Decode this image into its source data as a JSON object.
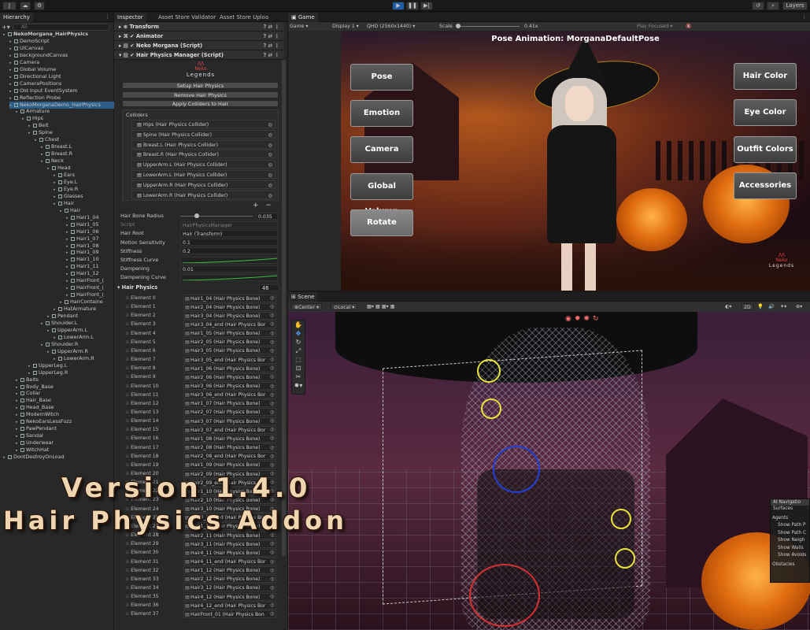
{
  "toolbar": {
    "account": "J",
    "layers_label": "Layers"
  },
  "hierarchy": {
    "tab_label": "Hierarchy",
    "search_placeholder": "All",
    "rows": [
      {
        "label": "NekoMorgana_HairPhysics",
        "indent": 0,
        "bold": true
      },
      {
        "label": "DemoScript",
        "indent": 1
      },
      {
        "label": "UICanvas",
        "indent": 1
      },
      {
        "label": "backgroundCanvas",
        "indent": 1
      },
      {
        "label": "Camera",
        "indent": 1
      },
      {
        "label": "Global Volume",
        "indent": 1
      },
      {
        "label": "Directional Light",
        "indent": 1
      },
      {
        "label": "CameraPositions",
        "indent": 1
      },
      {
        "label": "Old Input EventSystem",
        "indent": 1
      },
      {
        "label": "Reflection Probe",
        "indent": 1
      },
      {
        "label": "NekoMorganaDemo_HairPhysics",
        "indent": 1
      },
      {
        "label": "Armature",
        "indent": 2
      },
      {
        "label": "Hips",
        "indent": 3
      },
      {
        "label": "Belt",
        "indent": 4
      },
      {
        "label": "Spine",
        "indent": 4
      },
      {
        "label": "Chest",
        "indent": 5
      },
      {
        "label": "Breast.L",
        "indent": 6
      },
      {
        "label": "Breast.R",
        "indent": 6
      },
      {
        "label": "Neck",
        "indent": 6
      },
      {
        "label": "Head",
        "indent": 7
      },
      {
        "label": "Ears",
        "indent": 8
      },
      {
        "label": "Eye.L",
        "indent": 8
      },
      {
        "label": "Eye.R",
        "indent": 8
      },
      {
        "label": "Glasses",
        "indent": 8
      },
      {
        "label": "Hair",
        "indent": 8
      },
      {
        "label": "Hair",
        "indent": 9
      },
      {
        "label": "Hair1_04",
        "indent": 10
      },
      {
        "label": "Hair1_05",
        "indent": 10
      },
      {
        "label": "Hair1_06",
        "indent": 10
      },
      {
        "label": "Hair1_07",
        "indent": 10
      },
      {
        "label": "Hair1_08",
        "indent": 10
      },
      {
        "label": "Hair1_09",
        "indent": 10
      },
      {
        "label": "Hair1_10",
        "indent": 10
      },
      {
        "label": "Hair1_11",
        "indent": 10
      },
      {
        "label": "Hair1_12",
        "indent": 10
      },
      {
        "label": "HairFront_(",
        "indent": 10
      },
      {
        "label": "HairFront_(",
        "indent": 10
      },
      {
        "label": "HairFront_(",
        "indent": 10
      },
      {
        "label": "HairContaine",
        "indent": 9
      },
      {
        "label": "HatArmature",
        "indent": 8
      },
      {
        "label": "Pendant",
        "indent": 7
      },
      {
        "label": "Shoulder.L",
        "indent": 6
      },
      {
        "label": "UpperArm.L",
        "indent": 7
      },
      {
        "label": "LowerArm.L",
        "indent": 8
      },
      {
        "label": "Shoulder.R",
        "indent": 6
      },
      {
        "label": "UpperArm.R",
        "indent": 7
      },
      {
        "label": "LowerArm.R",
        "indent": 8
      },
      {
        "label": "UpperLeg.L",
        "indent": 4
      },
      {
        "label": "UpperLeg.R",
        "indent": 4
      },
      {
        "label": "Belts",
        "indent": 2
      },
      {
        "label": "Body_Base",
        "indent": 2
      },
      {
        "label": "Collar",
        "indent": 2
      },
      {
        "label": "Hair_Base",
        "indent": 2
      },
      {
        "label": "Head_Base",
        "indent": 2
      },
      {
        "label": "ModernWitch",
        "indent": 2
      },
      {
        "label": "NekoEarsLessFuzz",
        "indent": 2
      },
      {
        "label": "PawPendant",
        "indent": 2
      },
      {
        "label": "Sandal",
        "indent": 2
      },
      {
        "label": "Underwear",
        "indent": 2
      },
      {
        "label": "WitchHat",
        "indent": 2
      },
      {
        "label": "DontDestroyOnLoad",
        "indent": 0
      }
    ]
  },
  "inspector": {
    "tabs": [
      "Inspector",
      "Asset Store Validator",
      "Asset Store Uploa"
    ],
    "components": [
      "Transform",
      "Animator",
      "Neko Morgana (Script)",
      "Hair Physics Manager (Script)"
    ],
    "logo_top": "Neko",
    "logo_bottom": "Legends",
    "buttons": [
      "Setup Hair Physics",
      "Remove Hair Physics",
      "Apply Colliders to Hair"
    ],
    "colliders_label": "Colliders",
    "colliders": [
      "Hips (Hair Physics Collider)",
      "Spine (Hair Physics Collider)",
      "Breast.L (Hair Physics Collider)",
      "Breast.R (Hair Physics Collider)",
      "UpperArm.L (Hair Physics Collider)",
      "LowerArm.L (Hair Physics Collider)",
      "UpperArm.R (Hair Physics Collider)",
      "LowerArm.R (Hair Physics Collider)"
    ],
    "props": [
      {
        "label": "Hair Bone Radius",
        "value": "0.035",
        "slider": 0.2
      },
      {
        "label": "Script",
        "value": "HairPhysicsManager"
      },
      {
        "label": "Hair Root",
        "value": "Hair (Transform)"
      },
      {
        "label": "Motion Sensitivity",
        "value": "0.1"
      },
      {
        "label": "Stiffness",
        "value": "0.2"
      },
      {
        "label": "Stiffness Curve",
        "value": ""
      },
      {
        "label": "Dampening",
        "value": "0.01"
      },
      {
        "label": "Dampening Curve",
        "value": ""
      }
    ],
    "hair_physics_label": "Hair Physics",
    "hair_physics_count": "46",
    "elements": [
      {
        "label": "Element 0",
        "value": "Hair1_04 (Hair Physics Bone)"
      },
      {
        "label": "Element 1",
        "value": "Hair2_04 (Hair Physics Bone)"
      },
      {
        "label": "Element 2",
        "value": "Hair3_04 (Hair Physics Bone)"
      },
      {
        "label": "Element 3",
        "value": "Hair3_04_end (Hair Physics Bor"
      },
      {
        "label": "Element 4",
        "value": "Hair1_05 (Hair Physics Bone)"
      },
      {
        "label": "Element 5",
        "value": "Hair2_05 (Hair Physics Bone)"
      },
      {
        "label": "Element 6",
        "value": "Hair3_05 (Hair Physics Bone)"
      },
      {
        "label": "Element 7",
        "value": "Hair3_05_end (Hair Physics Bor"
      },
      {
        "label": "Element 8",
        "value": "Hair1_06 (Hair Physics Bone)"
      },
      {
        "label": "Element 9",
        "value": "Hair2_06 (Hair Physics Bone)"
      },
      {
        "label": "Element 10",
        "value": "Hair3_06 (Hair Physics Bone)"
      },
      {
        "label": "Element 11",
        "value": "Hair3_06_end (Hair Physics Bor"
      },
      {
        "label": "Element 12",
        "value": "Hair1_07 (Hair Physics Bone)"
      },
      {
        "label": "Element 13",
        "value": "Hair2_07 (Hair Physics Bone)"
      },
      {
        "label": "Element 14",
        "value": "Hair3_07 (Hair Physics Bone)"
      },
      {
        "label": "Element 15",
        "value": "Hair3_07_end (Hair Physics Bor"
      },
      {
        "label": "Element 16",
        "value": "Hair1_08 (Hair Physics Bone)"
      },
      {
        "label": "Element 17",
        "value": "Hair2_08 (Hair Physics Bone)"
      },
      {
        "label": "Element 18",
        "value": "Hair2_08_end (Hair Physics Bor"
      },
      {
        "label": "Element 19",
        "value": "Hair1_09 (Hair Physics Bone)"
      },
      {
        "label": "Element 20",
        "value": "Hair2_09 (Hair Physics Bone)"
      },
      {
        "label": "Element 21",
        "value": "Hair2_09_end (Hair Physics Bor"
      },
      {
        "label": "Element 22",
        "value": "Hair1_10 (Hair Physics Bone)"
      },
      {
        "label": "Element 23",
        "value": "Hair2_10 (Hair Physics Bone)"
      },
      {
        "label": "Element 24",
        "value": "Hair3_10 (Hair Physics Bone)"
      },
      {
        "label": "Element 25",
        "value": "Hair3_10_end (Hair Physics Bor"
      },
      {
        "label": "Element 27",
        "value": "Hair1_11 (Hair Physics Bone)"
      },
      {
        "label": "Element 28",
        "value": "Hair2_11 (Hair Physics Bone)"
      },
      {
        "label": "Element 29",
        "value": "Hair3_11 (Hair Physics Bone)"
      },
      {
        "label": "Element 30",
        "value": "Hair4_11 (Hair Physics Bone)"
      },
      {
        "label": "Element 31",
        "value": "Hair4_11_end (Hair Physics Bor"
      },
      {
        "label": "Element 32",
        "value": "Hair1_12 (Hair Physics Bone)"
      },
      {
        "label": "Element 33",
        "value": "Hair2_12 (Hair Physics Bone)"
      },
      {
        "label": "Element 34",
        "value": "Hair3_12 (Hair Physics Bone)"
      },
      {
        "label": "Element 35",
        "value": "Hair4_12 (Hair Physics Bone)"
      },
      {
        "label": "Element 36",
        "value": "Hair4_12_end (Hair Physics Bor"
      },
      {
        "label": "Element 37",
        "value": "HairFront_01 (Hair Physics Bon"
      }
    ]
  },
  "game": {
    "tab_label": "Game",
    "mode": "Game",
    "display": "Display 1",
    "resolution": "QHD (2560x1440)",
    "scale_label": "Scale",
    "scale_value": "0.41x",
    "play_focused": "Play Focused",
    "pose_title": "Pose Animation: MorganaDefaultPose",
    "left_buttons": [
      "Pose",
      "Emotion",
      "Camera",
      "Global Volumn",
      "Rotate"
    ],
    "right_buttons": [
      "Hair Color",
      "Eye Color",
      "Outfit Colors",
      "Accessories"
    ],
    "logo_top": "Neko",
    "logo_bottom": "Legends"
  },
  "scene": {
    "tab_label": "Scene",
    "pivot": "Center",
    "space": "Local",
    "mode_2d": "2D",
    "ai_nav": {
      "title": "AI Navigatio",
      "items": [
        "Surfaces",
        "Agents",
        "Show Path P",
        "Show Path C",
        "Show Neigh",
        "Show Walls",
        "Show Avoids",
        "Obstacles"
      ]
    }
  },
  "overlay": {
    "line1": "Version 1.4.0",
    "line2": "Hair Physics Addon"
  }
}
